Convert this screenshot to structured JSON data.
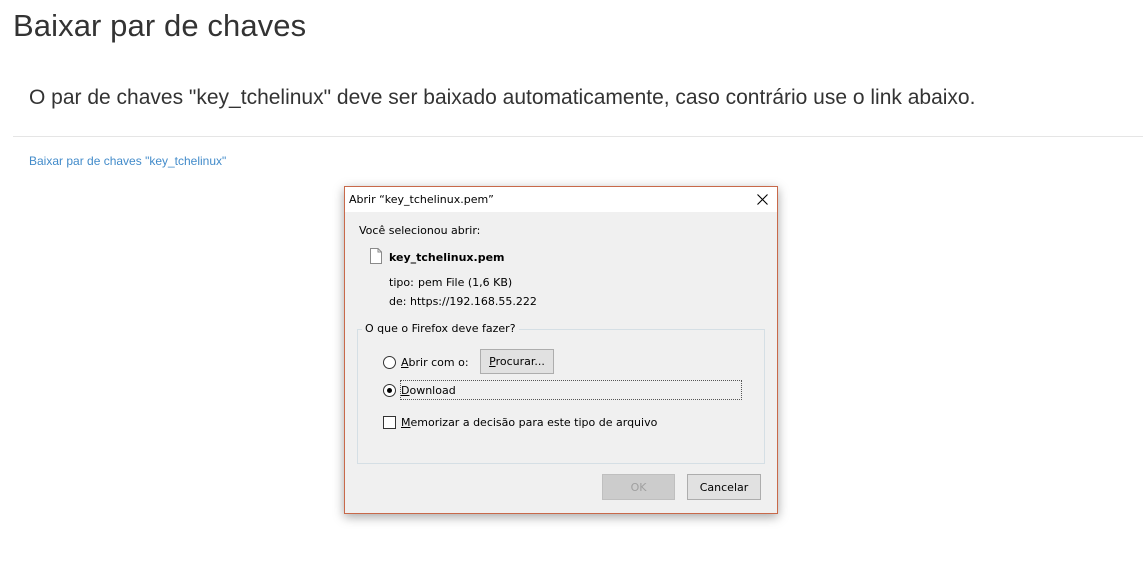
{
  "page": {
    "title": "Baixar par de chaves",
    "lead": "O par de chaves \"key_tchelinux\" deve ser baixado automaticamente, caso contrário use o link abaixo.",
    "link": "Baixar par de chaves \"key_tchelinux\""
  },
  "dialog": {
    "title": "Abrir “key_tchelinux.pem”",
    "selected_label": "Você selecionou abrir:",
    "filename": "key_tchelinux.pem",
    "type_label": "tipo:",
    "type_value": "pem File (1,6 KB)",
    "from_label": "de:",
    "from_value": "https://192.168.55.222",
    "group_label": "O que o Firefox deve fazer?",
    "open_with_label": "Abrir com o:",
    "browse_button": "Procurar...",
    "download_label": "Download",
    "remember_label": "Memorizar a decisão para este tipo de arquivo",
    "ok_button": "OK",
    "cancel_button": "Cancelar",
    "selected_option": "Download",
    "remember_checked": false
  },
  "colors": {
    "link": "#428bca",
    "dialog_border": "#c8694a"
  }
}
